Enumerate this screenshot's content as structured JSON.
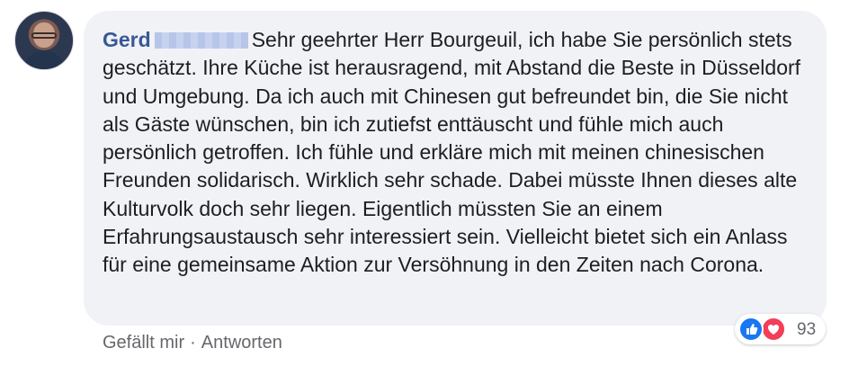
{
  "comment": {
    "author": "Gerd",
    "text": "Sehr geehrter Herr Bourgeuil, ich habe Sie persönlich stets geschätzt. Ihre Küche ist herausragend, mit Abstand die Beste in Düsseldorf und Umgebung. Da ich auch mit Chinesen gut befreundet bin, die Sie nicht als Gäste wünschen, bin ich zutiefst enttäuscht und fühle mich auch persönlich getroffen. Ich fühle und erkläre mich mit meinen chinesischen Freunden solidarisch. Wirklich sehr schade. Dabei müsste Ihnen dieses alte Kulturvolk doch sehr liegen. Eigentlich müssten Sie an einem Erfahrungsaustausch sehr interessiert sein. Vielleicht bietet sich ein Anlass für eine gemeinsame Aktion zur Versöhnung in den Zeiten nach Corona."
  },
  "actions": {
    "like_label": "Gefällt mir",
    "separator": "·",
    "reply_label": "Antworten"
  },
  "reactions": {
    "count": "93",
    "icons": [
      "like-icon",
      "love-icon"
    ]
  },
  "colors": {
    "author": "#385898",
    "bubble": "#f0f2f5",
    "like": "#1877f2",
    "love": "#f33e58"
  }
}
